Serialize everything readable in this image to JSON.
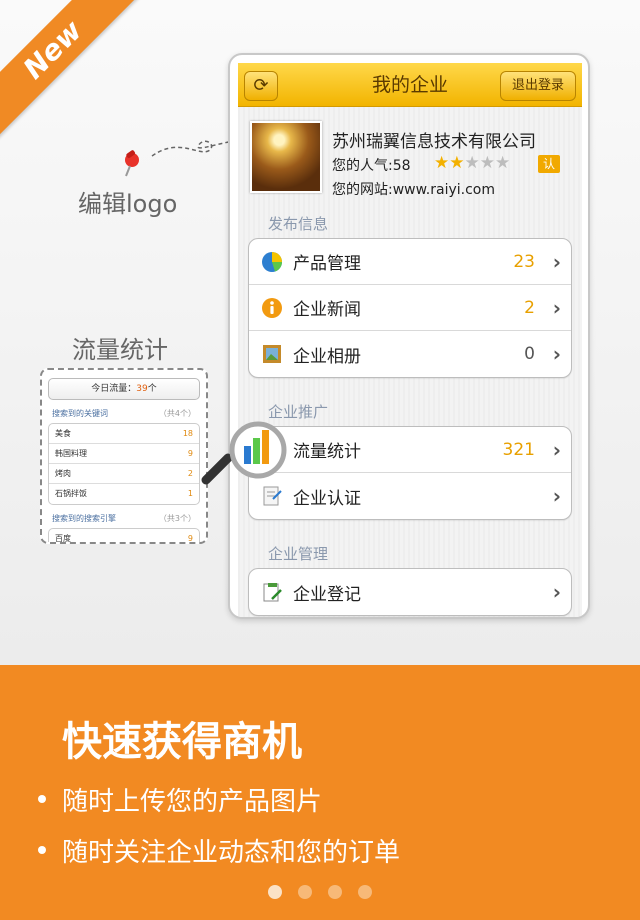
{
  "badge": "New",
  "annotations": {
    "edit_logo": "编辑logo",
    "traffic": "流量统计"
  },
  "mini_traffic": {
    "today_label": "今日流量：",
    "today_value": "39",
    "today_unit": "个",
    "keywords_title": "搜索到的关键词",
    "keywords_count": "（共4个）",
    "keywords": [
      {
        "name": "美食",
        "value": "18"
      },
      {
        "name": "韩国料理",
        "value": "9"
      },
      {
        "name": "烤肉",
        "value": "2"
      },
      {
        "name": "石锅拌饭",
        "value": "1"
      }
    ],
    "engines_title": "搜索到的搜索引擎",
    "engines_count": "（共3个）",
    "engines": [
      {
        "name": "百度",
        "value": "9"
      }
    ]
  },
  "phone": {
    "nav": {
      "refresh_icon": "refresh-icon",
      "title": "我的企业",
      "logout": "退出登录"
    },
    "company": {
      "name": "苏州瑞翼信息技术有限公司",
      "popularity": "您的人气:58",
      "stars_filled": 2,
      "stars_total": 5,
      "verified_badge": "认",
      "website": "您的网站:www.raiyi.com"
    },
    "sections": [
      {
        "title": "发布信息",
        "rows": [
          {
            "label": "产品管理",
            "value": "23",
            "icon": "pie-chart-icon"
          },
          {
            "label": "企业新闻",
            "value": "2",
            "icon": "info-icon"
          },
          {
            "label": "企业相册",
            "value": "0",
            "icon": "photo-frame-icon"
          }
        ]
      },
      {
        "title": "企业推广",
        "rows": [
          {
            "label": "流量统计",
            "value": "321",
            "icon": "bar-chart-icon"
          },
          {
            "label": "企业认证",
            "value": "",
            "icon": "certificate-icon"
          }
        ]
      },
      {
        "title": "企业管理",
        "rows": [
          {
            "label": "企业登记",
            "value": "",
            "icon": "register-icon"
          }
        ]
      }
    ]
  },
  "banner": {
    "title": "快速获得商机",
    "items": [
      "随时上传您的产品图片",
      "随时关注企业动态和您的订单"
    ],
    "page_count": 4,
    "active_page": 1
  },
  "colors": {
    "orange": "#f28a22",
    "nav_yellow": "#f2b400",
    "value_orange": "#e8a000"
  }
}
